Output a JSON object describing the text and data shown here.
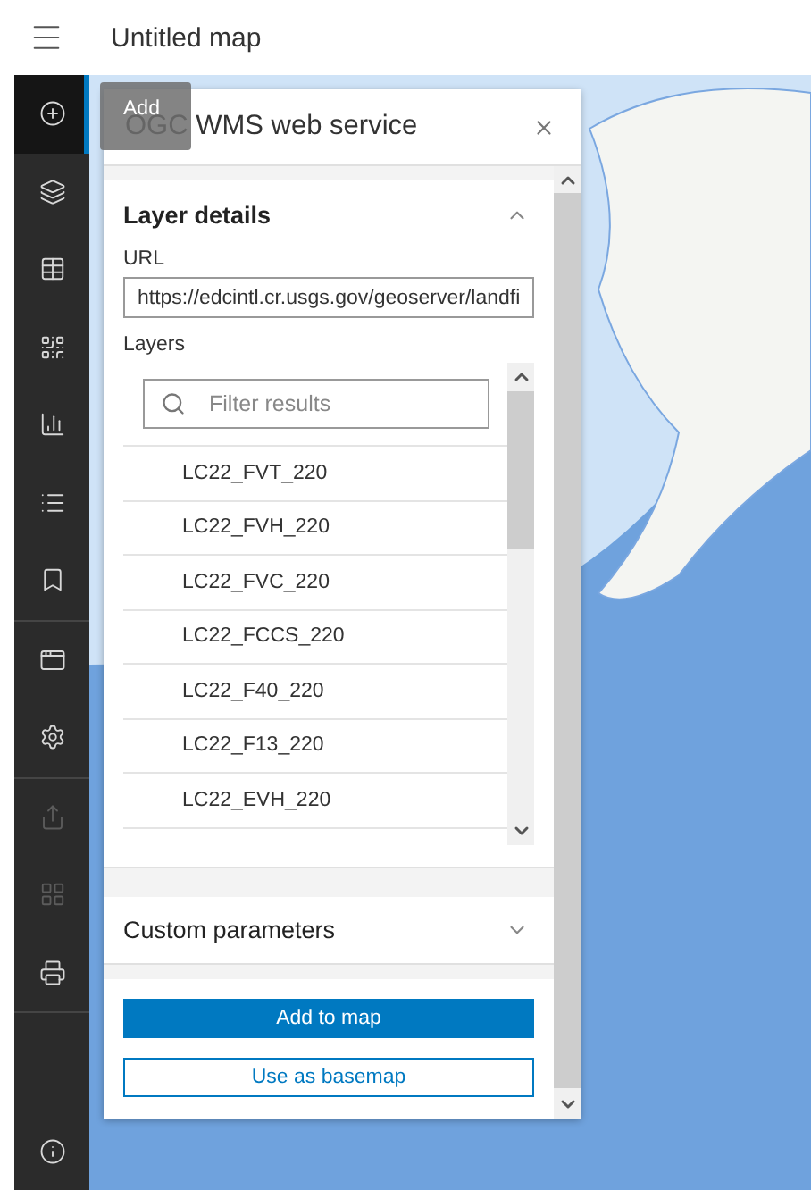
{
  "header": {
    "title": "Untitled map"
  },
  "rail": {
    "groups": [
      [
        {
          "selected": true,
          "disabled": false
        },
        {
          "selected": false,
          "disabled": false
        },
        {
          "selected": false,
          "disabled": false
        },
        {
          "selected": false,
          "disabled": false
        },
        {
          "selected": false,
          "disabled": false
        },
        {
          "selected": false,
          "disabled": false
        },
        {
          "selected": false,
          "disabled": false
        }
      ],
      [
        {
          "selected": false,
          "disabled": false
        },
        {
          "selected": false,
          "disabled": false
        }
      ],
      [
        {
          "selected": false,
          "disabled": true
        },
        {
          "selected": false,
          "disabled": true
        },
        {
          "selected": false,
          "disabled": false
        }
      ]
    ],
    "footer": [
      {
        "selected": false,
        "disabled": false
      }
    ]
  },
  "tooltip": {
    "text": "Add"
  },
  "panel": {
    "title": "OGC WMS web service",
    "sections": [
      {
        "title": "Layer details",
        "expanded": true
      },
      {
        "title": "Custom parameters",
        "expanded": false
      }
    ],
    "url": {
      "label": "URL",
      "value": "https://edcintl.cr.usgs.gov/geoserver/landfi"
    },
    "layers": {
      "label": "Layers",
      "search": {
        "placeholder": "Filter results"
      },
      "items": [
        "LC22_FVT_220",
        "LC22_FVH_220",
        "LC22_FVC_220",
        "LC22_FCCS_220",
        "LC22_F40_220",
        "LC22_F13_220",
        "LC22_EVH_220"
      ]
    },
    "buttons": [
      {
        "label": "Add to map",
        "kind": "primary"
      },
      {
        "label": "Use as basemap",
        "kind": "outline"
      }
    ]
  }
}
